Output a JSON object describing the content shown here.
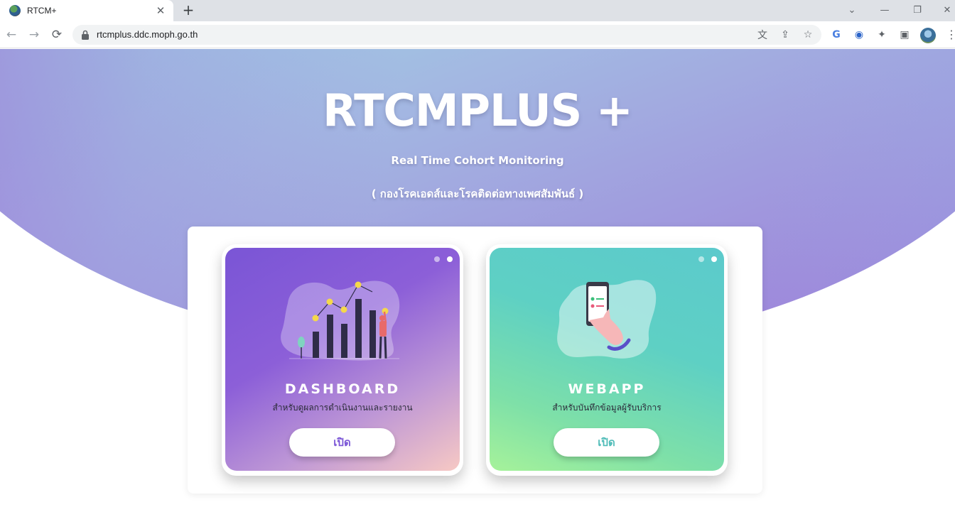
{
  "browser": {
    "tab_title": "RTCM+",
    "close_glyph": "✕",
    "newtab_glyph": "+",
    "url": "rtcmplus.ddc.moph.go.th",
    "win_controls": {
      "dropdown": "⌄",
      "minimize": "—",
      "restore": "❐",
      "close": "✕"
    },
    "nav": {
      "back": "←",
      "forward": "→",
      "reload": "⟳"
    },
    "omni_icons": {
      "translate": "文",
      "share": "⇪",
      "bookmark": "☆"
    },
    "extensions": {
      "google_translate": "G",
      "extension_blue": "◉",
      "puzzle": "✦",
      "sidepanel": "▣"
    },
    "menu": "⋮"
  },
  "hero": {
    "title": "RTCMPLUS +",
    "subtitle": "Real Time Cohort Monitoring",
    "org": "( กองโรคเอดส์และโรคติดต่อทางเพศสัมพันธ์ )"
  },
  "cards": [
    {
      "title": "DASHBOARD",
      "description": "สำหรับดูผลการดำเนินงานและรายงาน",
      "button": "เปิด",
      "accent": "#7a55d6"
    },
    {
      "title": "WEBAPP",
      "description": "สำหรับบันทึกข้อมูลผู้รับบริการ",
      "button": "เปิด",
      "accent": "#4fbcb8"
    }
  ]
}
